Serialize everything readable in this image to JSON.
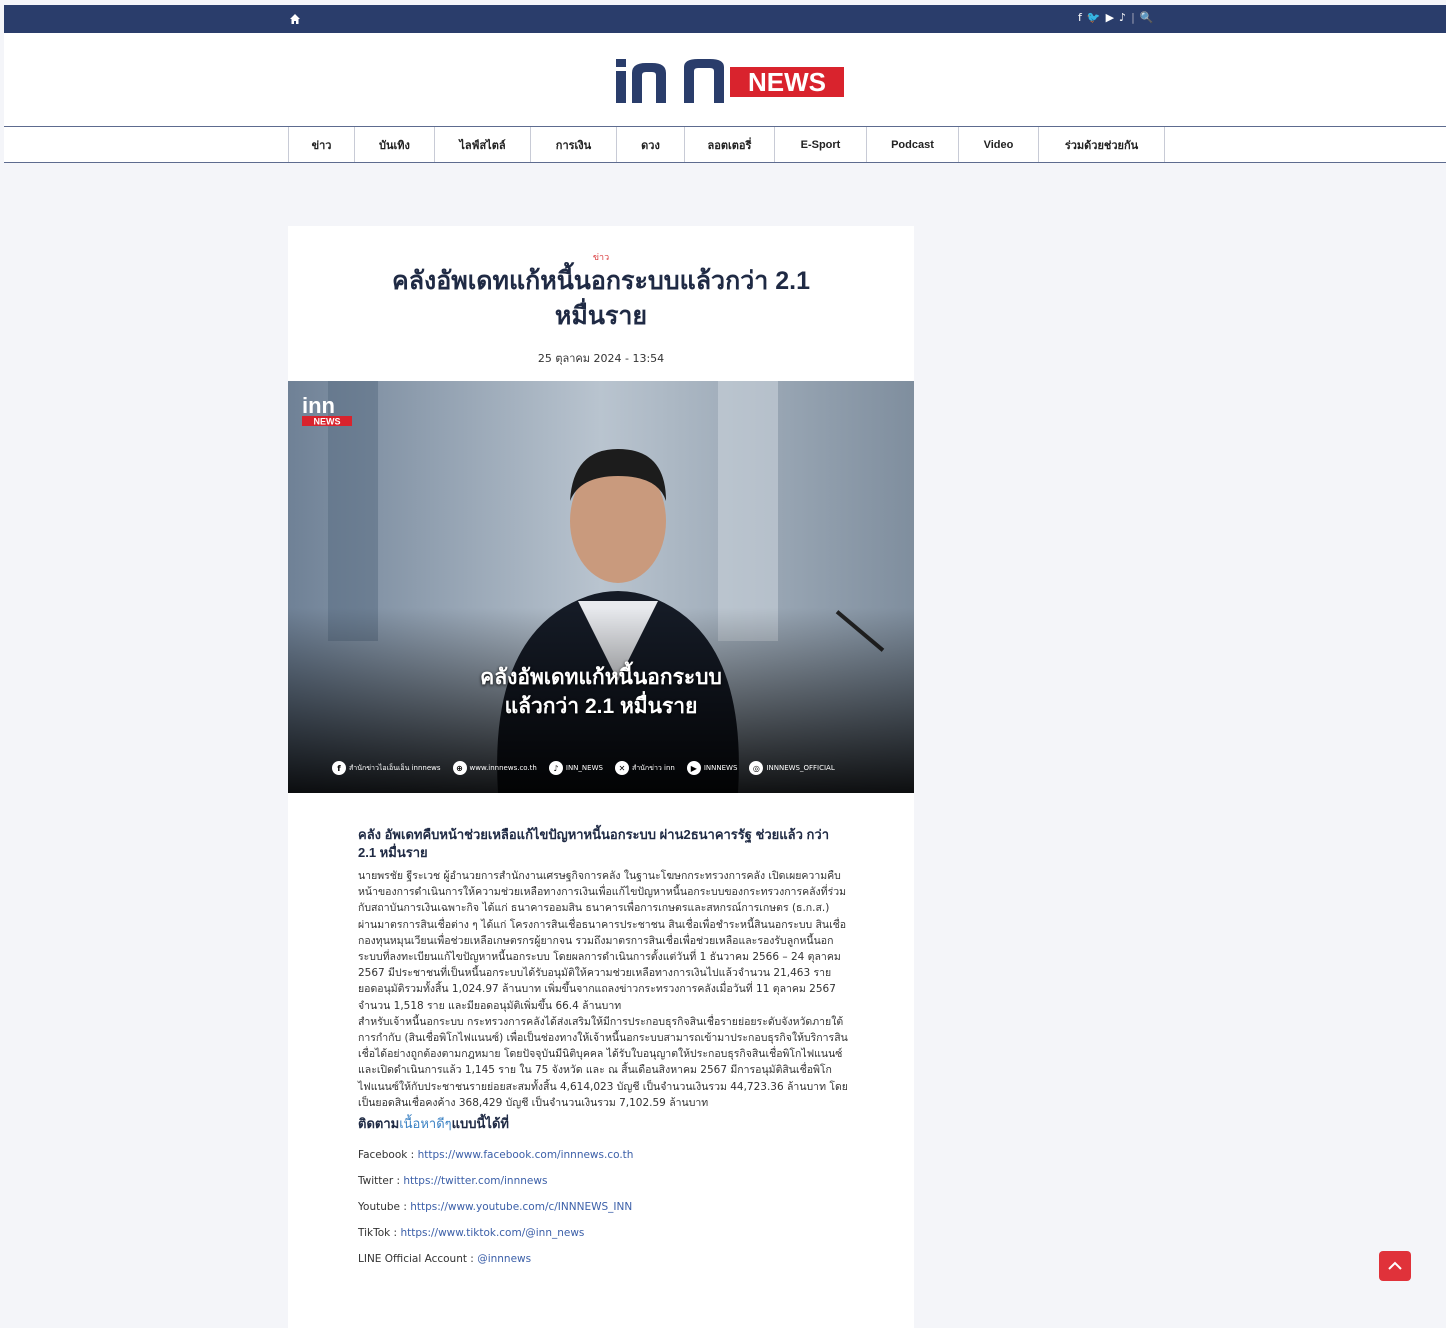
{
  "topbar": {
    "home_icon": "home-icon",
    "social_icons": [
      "f",
      "🐦",
      "▶",
      "♪",
      "|",
      "🔍"
    ]
  },
  "logo": {
    "inn": "inn",
    "news": "NEWS"
  },
  "nav": {
    "items": [
      {
        "label": "ข่าว"
      },
      {
        "label": "บันเทิง"
      },
      {
        "label": "ไลฟ์สไตล์"
      },
      {
        "label": "การเงิน"
      },
      {
        "label": "ดวง"
      },
      {
        "label": "ลอตเตอรี่"
      },
      {
        "label": "E-Sport"
      },
      {
        "label": "Podcast"
      },
      {
        "label": "Video"
      },
      {
        "label": "ร่วมด้วยช่วยกัน"
      }
    ]
  },
  "article": {
    "category": "ข่าว",
    "title": "คลังอัพเดทแก้หนี้นอกระบบแล้วกว่า 2.1 หมื่นราย",
    "date": "25 ตุลาคม 2024 - 13:54",
    "hero": {
      "logo_top": "inn",
      "logo_bottom": "NEWS",
      "caption_line1": "คลังอัพเดทแก้หนี้นอกระบบ",
      "caption_line2": "แล้วกว่า 2.1 หมื่นราย",
      "social": [
        {
          "icon": "f",
          "text": "สำนักข่าวไอเอ็นเอ็น innnews"
        },
        {
          "icon": "⊕",
          "text": "www.innnews.co.th"
        },
        {
          "icon": "♪",
          "text": "INN_NEWS"
        },
        {
          "icon": "✕",
          "text": "สำนักข่าว inn"
        },
        {
          "icon": "▶",
          "text": "INNNEWS"
        },
        {
          "icon": "◎",
          "text": "INNNEWS_OFFICIAL"
        }
      ]
    },
    "subhead": "คลัง อัพเดทคืบหน้าช่วยเหลือแก้ไขปัญหาหนี้นอกระบบ ผ่าน2ธนาคารรัฐ ช่วยแล้ว กว่า 2.1 หมื่นราย",
    "paragraphs": [
      "นายพรชัย ฐีระเวช ผู้อำนวยการสำนักงานเศรษฐกิจการคลัง ในฐานะโฆษกกระทรวงการคลัง เปิดเผยความคืบหน้าของการดำเนินการให้ความช่วยเหลือทางการเงินเพื่อแก้ไขปัญหาหนี้นอกระบบของกระทรวงการคลังที่ร่วมกับสถาบันการเงินเฉพาะกิจ ได้แก่ ธนาคารออมสิน ธนาคารเพื่อการเกษตรและสหกรณ์การเกษตร (ธ.ก.ส.) ผ่านมาตรการสินเชื่อต่าง ๆ ได้แก่ โครงการสินเชื่อธนาคารประชาชน สินเชื่อเพื่อชำระหนี้สินนอกระบบ สินเชื่อกองทุนหมุนเวียนเพื่อช่วยเหลือเกษตรกรผู้ยากจน รวมถึงมาตรการสินเชื่อเพื่อช่วยเหลือและรองรับลูกหนี้นอกระบบที่ลงทะเบียนแก้ไขปัญหาหนี้นอกระบบ โดยผลการดำเนินการตั้งแต่วันที่ 1 ธันวาคม 2566 – 24 ตุลาคม 2567 มีประชาชนที่เป็นหนี้นอกระบบได้รับอนุมัติให้ความช่วยเหลือทางการเงินไปแล้วจำนวน 21,463 ราย ยอดอนุมัติรวมทั้งสิ้น 1,024.97 ล้านบาท เพิ่มขึ้นจากแถลงข่าวกระทรวงการคลังเมื่อวันที่ 11 ตุลาคม 2567 จำนวน 1,518 ราย และมียอดอนุมัติเพิ่มขึ้น 66.4 ล้านบาท",
      "สำหรับเจ้าหนี้นอกระบบ กระทรวงการคลังได้ส่งเสริมให้มีการประกอบธุรกิจสินเชื่อรายย่อยระดับจังหวัดภายใต้การกำกับ (สินเชื่อพิโกไฟแนนซ์) เพื่อเป็นช่องทางให้เจ้าหนี้นอกระบบสามารถเข้ามาประกอบธุรกิจให้บริการสินเชื่อได้อย่างถูกต้องตามกฎหมาย โดยปัจจุบันมีนิติบุคคล ได้รับใบอนุญาตให้ประกอบธุรกิจสินเชื่อพิโกไฟแนนซ์และเปิดดำเนินการแล้ว 1,145 ราย ใน 75 จังหวัด และ ณ สิ้นเดือนสิงหาคม 2567 มีการอนุมัติสินเชื่อพิโกไฟแนนซ์ให้กับประชาชนรายย่อยสะสมทั้งสิ้น 4,614,023 บัญชี เป็นจำนวนเงินรวม 44,723.36 ล้านบาท โดยเป็นยอดสินเชื่อคงค้าง 368,429 บัญชี เป็นจำนวนเงินรวม 7,102.59 ล้านบาท"
    ],
    "follow_prefix": "ติดตาม",
    "follow_link": "เนื้อหาดีๆ",
    "follow_suffix": "แบบนี้ได้ที่",
    "socials": [
      {
        "label": "Facebook : ",
        "url": "https://www.facebook.com/innnews.co.th"
      },
      {
        "label": "Twitter : ",
        "url": "https://twitter.com/innnews"
      },
      {
        "label": "Youtube : ",
        "url": "https://www.youtube.com/c/INNNEWS_INN"
      },
      {
        "label": "TikTok : ",
        "url": "https://www.tiktok.com/@inn_news"
      },
      {
        "label": "LINE Official Account : ",
        "url": "@innnews"
      }
    ]
  },
  "back_to_top_icon": "chevron-up-icon",
  "colors": {
    "topbar": "#2a3d6b",
    "accent": "#e0323a",
    "link": "#3b5fa8"
  }
}
